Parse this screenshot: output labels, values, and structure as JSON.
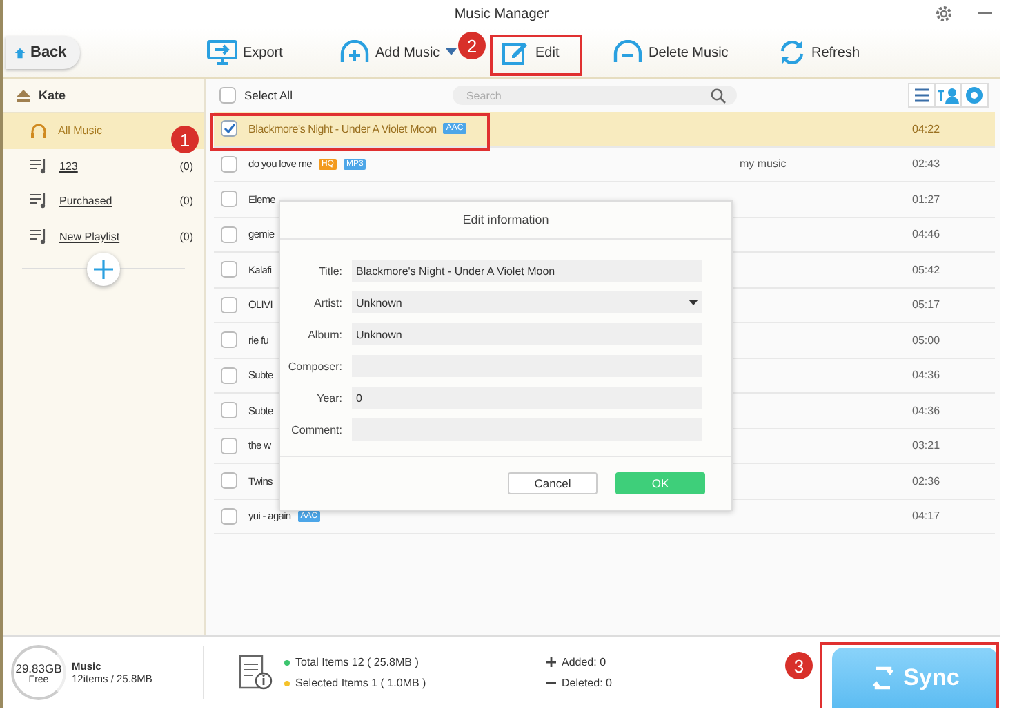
{
  "window": {
    "title": "Music Manager"
  },
  "back_button": "Back",
  "toolbar": [
    {
      "kind": "export",
      "label": "Export",
      "dropdown": false
    },
    {
      "kind": "add",
      "label": "Add Music",
      "dropdown": true
    },
    {
      "kind": "edit",
      "label": "Edit",
      "dropdown": false
    },
    {
      "kind": "delete",
      "label": "Delete Music",
      "dropdown": false
    },
    {
      "kind": "refresh",
      "label": "Refresh",
      "dropdown": false
    }
  ],
  "sidebar": {
    "device": "Kate",
    "items": [
      {
        "kind": "music",
        "label": "All Music",
        "selected": true
      },
      {
        "kind": "playlist",
        "label": "123",
        "count": "(0)",
        "selected": false
      },
      {
        "kind": "playlist",
        "label": "Purchased",
        "count": "(0)",
        "selected": false
      },
      {
        "kind": "playlist",
        "label": "New Playlist",
        "count": "(0)",
        "selected": false
      }
    ]
  },
  "list": {
    "select_all": {
      "label": "Select All",
      "checked": false
    },
    "search": {
      "placeholder": "Search"
    },
    "rows": [
      {
        "title": "Blackmore's Night - Under A Violet Moon",
        "tags": [
          {
            "label": "AAC",
            "color": "#4da6e8"
          }
        ],
        "album": "",
        "duration": "04:22",
        "checked": true,
        "selected": true
      },
      {
        "title": "do you love me",
        "tags": [
          {
            "label": "HQ",
            "color": "#f39a1e"
          },
          {
            "label": "MP3",
            "color": "#4da6e8"
          }
        ],
        "album": "my music",
        "duration": "02:43",
        "checked": false,
        "selected": false
      },
      {
        "title": "Eleme",
        "tags": [],
        "album": "",
        "duration": "01:27",
        "checked": false,
        "selected": false
      },
      {
        "title": "gemie",
        "tags": [],
        "album": "",
        "duration": "04:46",
        "checked": false,
        "selected": false
      },
      {
        "title": "Kalafi",
        "tags": [],
        "album": "",
        "duration": "05:42",
        "checked": false,
        "selected": false
      },
      {
        "title": "OLIVI",
        "tags": [],
        "album": "",
        "duration": "05:17",
        "checked": false,
        "selected": false
      },
      {
        "title": "rie fu",
        "tags": [],
        "album": "",
        "duration": "05:00",
        "checked": false,
        "selected": false
      },
      {
        "title": "Subte",
        "tags": [],
        "album": "",
        "duration": "04:36",
        "checked": false,
        "selected": false
      },
      {
        "title": "Subte",
        "tags": [],
        "album": "",
        "duration": "04:36",
        "checked": false,
        "selected": false
      },
      {
        "title": "the w",
        "tags": [],
        "album": "",
        "duration": "03:21",
        "checked": false,
        "selected": false
      },
      {
        "title": "Twins",
        "tags": [],
        "album": "",
        "duration": "02:36",
        "checked": false,
        "selected": false
      },
      {
        "title": "yui - again",
        "tags": [
          {
            "label": "AAC",
            "color": "#4da6e8"
          }
        ],
        "album": "",
        "duration": "04:17",
        "checked": false,
        "selected": false
      }
    ]
  },
  "dialog": {
    "title": "Edit information",
    "fields": [
      {
        "label": "Title:",
        "value": "Blackmore's Night - Under A Violet Moon",
        "kind": "text"
      },
      {
        "label": "Artist:",
        "value": "Unknown",
        "kind": "select"
      },
      {
        "label": "Album:",
        "value": "Unknown",
        "kind": "text"
      },
      {
        "label": "Composer:",
        "kind": "text"
      },
      {
        "label": "Year:",
        "value": "0",
        "kind": "text"
      },
      {
        "label": "Comment:",
        "kind": "text"
      }
    ],
    "cancel": "Cancel",
    "ok": "OK"
  },
  "footer": {
    "capacity": "29.83GB",
    "capacity_note": "Free",
    "library": "Music",
    "library_info": "12items / 25.8MB",
    "stats": [
      {
        "text": "Total Items 12 ( 25.8MB )",
        "color": "#3cc56e"
      },
      {
        "text": "Selected Items 1 ( 1.0MB )",
        "color": "#f5c22a"
      }
    ],
    "changes": [
      {
        "kind": "added",
        "text": "Added: 0"
      },
      {
        "kind": "deleted",
        "text": "Deleted: 0"
      }
    ],
    "sync": "Sync"
  },
  "annotations": [
    "1",
    "2",
    "3"
  ]
}
